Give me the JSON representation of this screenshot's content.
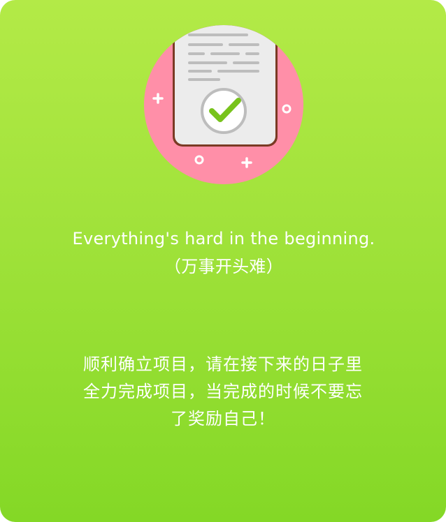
{
  "dialog": {
    "quote": "Everything's hard in the beginning.（万事开头难）",
    "message": "顺利确立项目，请在接下来的日子里全力完成项目，当完成的时候不要忘了奖励自己！"
  },
  "illustration": {
    "icon": "document-checkmark-icon",
    "colors": {
      "circle": "#ff8fa8",
      "paper": "#ececec",
      "check": "#78c31c",
      "sparkle": "#ffffff"
    }
  },
  "colors": {
    "gradient_top": "#b3ea47",
    "gradient_bottom": "#84d826",
    "text": "#ffffff"
  }
}
